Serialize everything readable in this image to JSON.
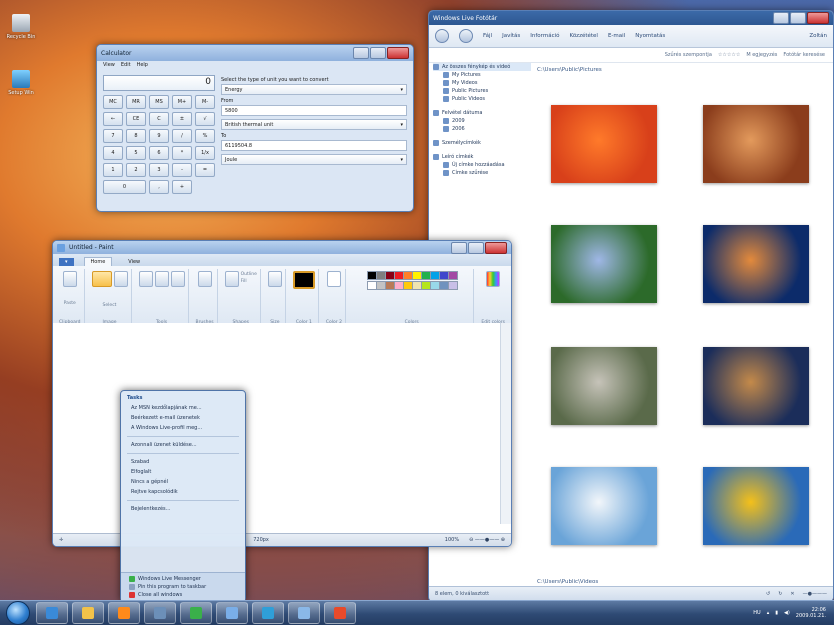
{
  "desktop": {
    "icons": [
      {
        "label": "Recycle Bin",
        "color": "#cfd6de"
      },
      {
        "label": "Setup Win",
        "color": "#3aa0d8"
      }
    ]
  },
  "gallery": {
    "title": "Windows Live Fotótár",
    "toolbar": [
      "Fájl",
      "Javítás",
      "Információ",
      "Közzététel",
      "E-mail",
      "Nyomtatás"
    ],
    "user": "Zoltán",
    "search_placeholder": "Fotótár keresése",
    "subbar": [
      "Szűrés szempontja",
      "Ismeretlen",
      "M egjegyzés"
    ],
    "sidebar": {
      "library_header": "Az összes fénykép és videó",
      "library_items": [
        "My Pictures",
        "My Videos",
        "Public Pictures",
        "Public Videos"
      ],
      "date_header": "Felvétel dátuma",
      "dates": [
        "2009",
        "2006"
      ],
      "people": "Személycímkék",
      "tags_header": "Leíró címkék",
      "tags": [
        "Új címke hozzáadása",
        "Címke szűrése"
      ]
    },
    "path_pictures": "C:\\Users\\Public\\Pictures",
    "path_videos": "C:\\Users\\Public\\Videos",
    "status": "8 elem, 0 kiválasztott",
    "photos": [
      {
        "name": "flower-red",
        "color1": "#d8401a",
        "color2": "#ff7a2a"
      },
      {
        "name": "desert",
        "color1": "#8b3d1c",
        "color2": "#e39a5c"
      },
      {
        "name": "hydrangea",
        "color1": "#2c6a2a",
        "color2": "#9fb7e6"
      },
      {
        "name": "jellyfish",
        "color1": "#0c2b6a",
        "color2": "#e38a3c"
      },
      {
        "name": "koala",
        "color1": "#5a6a4a",
        "color2": "#c6c3b9"
      },
      {
        "name": "lighthouse",
        "color1": "#1b2d5a",
        "color2": "#c48a4a"
      },
      {
        "name": "penguins",
        "color1": "#6aa4d8",
        "color2": "#f2f6fa"
      },
      {
        "name": "tulips",
        "color1": "#2a6ab8",
        "color2": "#f4c01a"
      }
    ]
  },
  "calc": {
    "title": "Calculator",
    "menu": [
      "View",
      "Edit",
      "Help"
    ],
    "display": "0",
    "keys": [
      "MC",
      "MR",
      "MS",
      "M+",
      "M-",
      "←",
      "CE",
      "C",
      "±",
      "√",
      "7",
      "8",
      "9",
      "/",
      "%",
      "4",
      "5",
      "6",
      "*",
      "1/x",
      "1",
      "2",
      "3",
      "-",
      "=",
      "0",
      ",",
      "+"
    ],
    "convert_prompt": "Select the type of unit you want to convert",
    "type": "Energy",
    "from_label": "From",
    "from_value": "5800",
    "from_unit": "British thermal unit",
    "to_label": "To",
    "to_value": "6119504.8",
    "to_unit": "Joule"
  },
  "paint": {
    "title": "Untitled - Paint",
    "tabs": [
      "Home",
      "View"
    ],
    "groups": [
      "Clipboard",
      "Image",
      "Tools",
      "Brushes",
      "Shapes",
      "Size",
      "Color 1",
      "Color 2",
      "Colors",
      "Edit colors"
    ],
    "tool_labels": {
      "paste": "Paste",
      "select": "Select",
      "outline": "Outline",
      "fill": "Fill"
    },
    "palette": [
      "#000000",
      "#7f7f7f",
      "#880015",
      "#ed1c24",
      "#ff7f27",
      "#fff200",
      "#22b14c",
      "#00a2e8",
      "#3f48cc",
      "#a349a4",
      "#ffffff",
      "#c3c3c3",
      "#b97a57",
      "#ffaec9",
      "#ffc90e",
      "#efe4b0",
      "#b5e61d",
      "#99d9ea",
      "#7092be",
      "#c8bfe7"
    ],
    "status_size": "720px",
    "zoom": "100%"
  },
  "jumplist": {
    "tasks_header": "Tasks",
    "tasks1": [
      "Az MSN kezdőlapjának me...",
      "Beérkezett e-mail üzenetek",
      "A Windows Live-profil meg..."
    ],
    "tasks2": [
      "Azonnali üzenet küldése..."
    ],
    "status": [
      "Szabad",
      "Elfoglalt",
      "Nincs a gépnél",
      "Rejtve kapcsolódik"
    ],
    "signin": "Bejelentkezés...",
    "bottom": [
      "Windows Live Messenger",
      "Pin this program to taskbar",
      "Close all windows"
    ]
  },
  "taskbar": {
    "apps": [
      {
        "name": "internet-explorer",
        "color": "#3a8ad8"
      },
      {
        "name": "explorer",
        "color": "#f2c24a"
      },
      {
        "name": "media-player",
        "color": "#ff8a1a"
      },
      {
        "name": "calculator",
        "color": "#6c8fb8"
      },
      {
        "name": "messenger",
        "color": "#3ab04a"
      },
      {
        "name": "paint",
        "color": "#7aaee8"
      },
      {
        "name": "photo-gallery",
        "color": "#2f9fd8"
      },
      {
        "name": "notepad",
        "color": "#8ab8e8"
      },
      {
        "name": "media-center",
        "color": "#e84a2a"
      }
    ],
    "lang": "HU",
    "time": "22:06",
    "date": "2009.01.21."
  }
}
